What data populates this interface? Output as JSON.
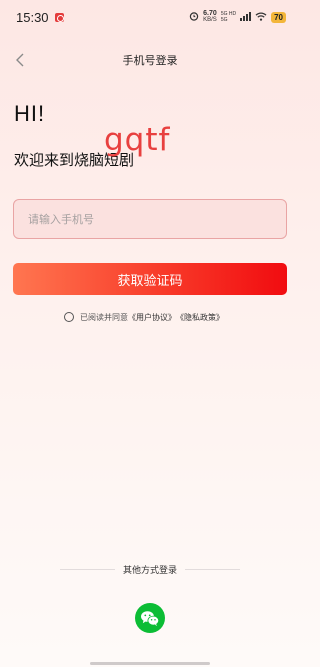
{
  "status_bar": {
    "time": "15:30",
    "net_speed_value": "6.70",
    "net_speed_unit": "KB/S",
    "net_type_top": "5G HD",
    "net_type_bottom": "5G",
    "battery": "70"
  },
  "header": {
    "title": "手机号登录"
  },
  "greeting": {
    "hi": "HI!",
    "welcome": "欢迎来到烧脑短剧"
  },
  "watermark": "gqtf",
  "phone_field": {
    "value": "",
    "placeholder": "请输入手机号"
  },
  "get_code_button": "获取验证码",
  "agreement": {
    "prefix": "已阅读并同意",
    "user_agreement": "《用户协议》",
    "privacy_policy": "《隐私政策》"
  },
  "other_login": {
    "label": "其他方式登录",
    "methods": [
      "wechat"
    ]
  },
  "colors": {
    "accent_gradient_start": "#ff7650",
    "accent_gradient_end": "#f10c10",
    "wechat_green": "#0cbd35",
    "watermark": "#e8403f"
  }
}
